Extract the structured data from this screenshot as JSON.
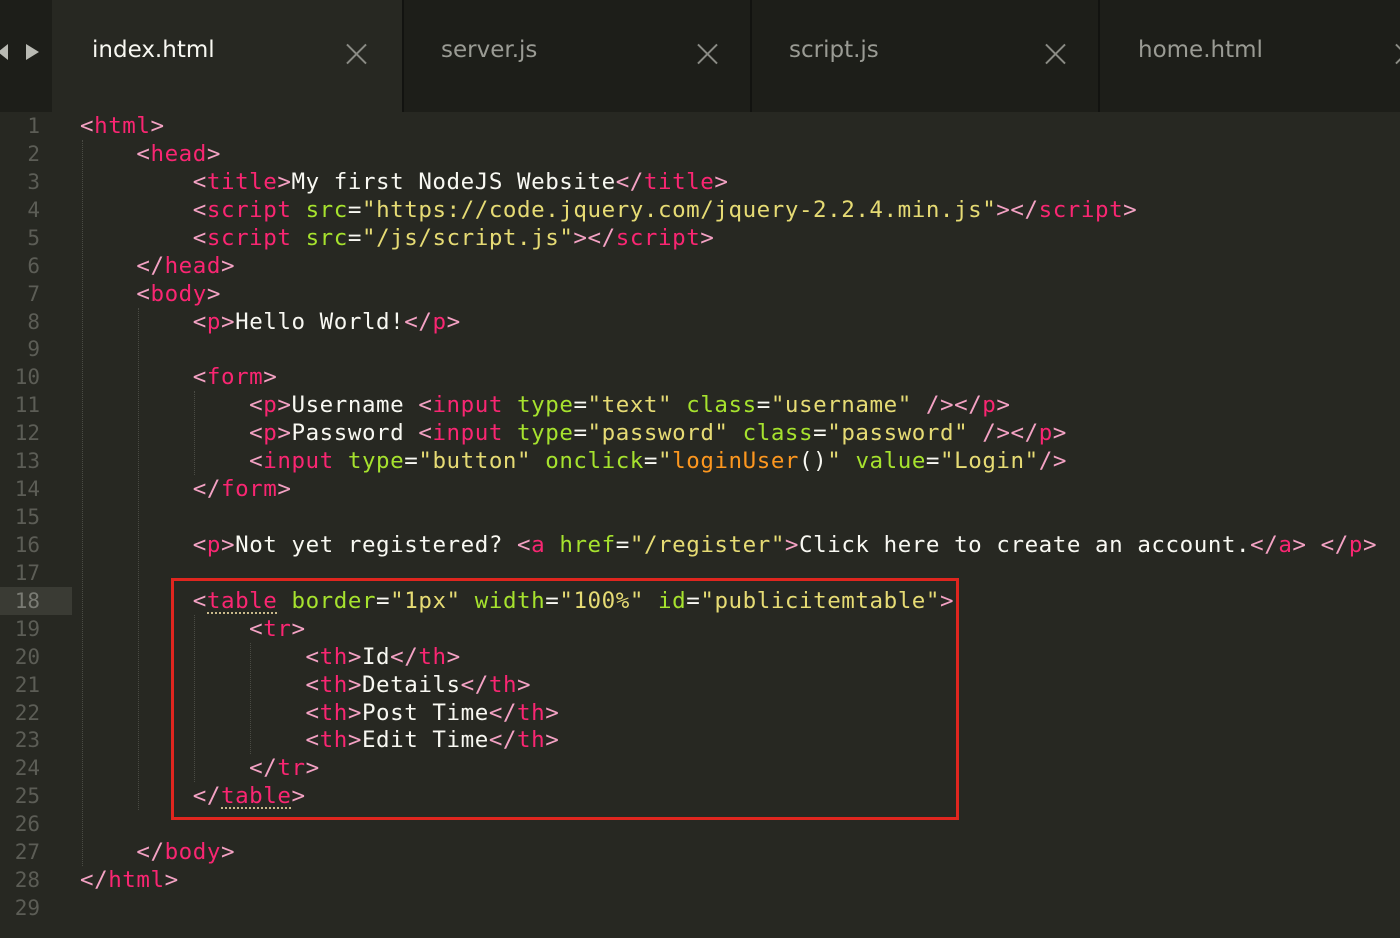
{
  "tabs": [
    {
      "label": "index.html",
      "active": true
    },
    {
      "label": "server.js",
      "active": false
    },
    {
      "label": "script.js",
      "active": false
    },
    {
      "label": "home.html",
      "active": false
    }
  ],
  "gutter": {
    "line_numbers": [
      "1",
      "2",
      "3",
      "4",
      "5",
      "6",
      "7",
      "8",
      "9",
      "10",
      "11",
      "12",
      "13",
      "14",
      "15",
      "16",
      "17",
      "18",
      "19",
      "20",
      "21",
      "22",
      "23",
      "24",
      "25",
      "26",
      "27",
      "28",
      "29"
    ],
    "current_line": "18"
  },
  "colors": {
    "tag": "#f92672",
    "attribute": "#a6e22e",
    "string": "#e6db74",
    "text": "#f8f8f2",
    "function": "#fd971f",
    "background": "#272822",
    "highlight_box": "#e0261f"
  },
  "code": {
    "lines": [
      [
        [
          "tag",
          "<"
        ],
        [
          "tagname",
          "html"
        ],
        [
          "tag",
          ">"
        ]
      ],
      [
        [
          "tag",
          "    <"
        ],
        [
          "tagname",
          "head"
        ],
        [
          "tag",
          ">"
        ]
      ],
      [
        [
          "tag",
          "        <"
        ],
        [
          "tagname",
          "title"
        ],
        [
          "tag",
          ">"
        ],
        [
          "text",
          "My first NodeJS Website"
        ],
        [
          "tag",
          "</"
        ],
        [
          "tagname",
          "title"
        ],
        [
          "tag",
          ">"
        ]
      ],
      [
        [
          "tag",
          "        <"
        ],
        [
          "tagname",
          "script"
        ],
        [
          "text",
          " "
        ],
        [
          "attr",
          "src"
        ],
        [
          "text",
          "="
        ],
        [
          "str",
          "\"https://code.jquery.com/jquery-2.2.4.min.js\""
        ],
        [
          "tag",
          "></"
        ],
        [
          "tagname",
          "script"
        ],
        [
          "tag",
          ">"
        ]
      ],
      [
        [
          "tag",
          "        <"
        ],
        [
          "tagname",
          "script"
        ],
        [
          "text",
          " "
        ],
        [
          "attr",
          "src"
        ],
        [
          "text",
          "="
        ],
        [
          "str",
          "\"/js/script.js\""
        ],
        [
          "tag",
          "></"
        ],
        [
          "tagname",
          "script"
        ],
        [
          "tag",
          ">"
        ]
      ],
      [
        [
          "tag",
          "    </"
        ],
        [
          "tagname",
          "head"
        ],
        [
          "tag",
          ">"
        ]
      ],
      [
        [
          "tag",
          "    <"
        ],
        [
          "tagname",
          "body"
        ],
        [
          "tag",
          ">"
        ]
      ],
      [
        [
          "tag",
          "        <"
        ],
        [
          "tagname",
          "p"
        ],
        [
          "tag",
          ">"
        ],
        [
          "text",
          "Hello World!"
        ],
        [
          "tag",
          "</"
        ],
        [
          "tagname",
          "p"
        ],
        [
          "tag",
          ">"
        ]
      ],
      [],
      [
        [
          "tag",
          "        <"
        ],
        [
          "tagname",
          "form"
        ],
        [
          "tag",
          ">"
        ]
      ],
      [
        [
          "tag",
          "            <"
        ],
        [
          "tagname",
          "p"
        ],
        [
          "tag",
          ">"
        ],
        [
          "text",
          "Username "
        ],
        [
          "tag",
          "<"
        ],
        [
          "tagname",
          "input"
        ],
        [
          "text",
          " "
        ],
        [
          "attr",
          "type"
        ],
        [
          "text",
          "="
        ],
        [
          "str",
          "\"text\""
        ],
        [
          "text",
          " "
        ],
        [
          "attr",
          "class"
        ],
        [
          "text",
          "="
        ],
        [
          "str",
          "\"username\""
        ],
        [
          "text",
          " "
        ],
        [
          "tag",
          "/></"
        ],
        [
          "tagname",
          "p"
        ],
        [
          "tag",
          ">"
        ]
      ],
      [
        [
          "tag",
          "            <"
        ],
        [
          "tagname",
          "p"
        ],
        [
          "tag",
          ">"
        ],
        [
          "text",
          "Password "
        ],
        [
          "tag",
          "<"
        ],
        [
          "tagname",
          "input"
        ],
        [
          "text",
          " "
        ],
        [
          "attr",
          "type"
        ],
        [
          "text",
          "="
        ],
        [
          "str",
          "\"password\""
        ],
        [
          "text",
          " "
        ],
        [
          "attr",
          "class"
        ],
        [
          "text",
          "="
        ],
        [
          "str",
          "\"password\""
        ],
        [
          "text",
          " "
        ],
        [
          "tag",
          "/></"
        ],
        [
          "tagname",
          "p"
        ],
        [
          "tag",
          ">"
        ]
      ],
      [
        [
          "tag",
          "            <"
        ],
        [
          "tagname",
          "input"
        ],
        [
          "text",
          " "
        ],
        [
          "attr",
          "type"
        ],
        [
          "text",
          "="
        ],
        [
          "str",
          "\"button\""
        ],
        [
          "text",
          " "
        ],
        [
          "attr",
          "onclick"
        ],
        [
          "text",
          "="
        ],
        [
          "str",
          "\""
        ],
        [
          "fn",
          "loginUser"
        ],
        [
          "text",
          "()"
        ],
        [
          "str",
          "\""
        ],
        [
          "text",
          " "
        ],
        [
          "attr",
          "value"
        ],
        [
          "text",
          "="
        ],
        [
          "str",
          "\"Login\""
        ],
        [
          "tag",
          "/>"
        ]
      ],
      [
        [
          "tag",
          "        </"
        ],
        [
          "tagname",
          "form"
        ],
        [
          "tag",
          ">"
        ]
      ],
      [],
      [
        [
          "tag",
          "        <"
        ],
        [
          "tagname",
          "p"
        ],
        [
          "tag",
          ">"
        ],
        [
          "text",
          "Not yet registered? "
        ],
        [
          "tag",
          "<"
        ],
        [
          "tagname",
          "a"
        ],
        [
          "text",
          " "
        ],
        [
          "attr",
          "href"
        ],
        [
          "text",
          "="
        ],
        [
          "str",
          "\"/register\""
        ],
        [
          "tag",
          ">"
        ],
        [
          "text",
          "Click here to create an account."
        ],
        [
          "tag",
          "</"
        ],
        [
          "tagname",
          "a"
        ],
        [
          "tag",
          ">"
        ],
        [
          "text",
          " "
        ],
        [
          "tag",
          "</"
        ],
        [
          "tagname",
          "p"
        ],
        [
          "tag",
          ">"
        ]
      ],
      [],
      [
        [
          "tag",
          "        <"
        ],
        [
          "tagname",
          "table"
        ],
        [
          "text",
          " "
        ],
        [
          "attr",
          "border"
        ],
        [
          "text",
          "="
        ],
        [
          "str",
          "\"1px\""
        ],
        [
          "text",
          " "
        ],
        [
          "attr",
          "width"
        ],
        [
          "text",
          "="
        ],
        [
          "str",
          "\"100%\""
        ],
        [
          "text",
          " "
        ],
        [
          "attr",
          "id"
        ],
        [
          "text",
          "="
        ],
        [
          "str",
          "\"publicitemtable\""
        ],
        [
          "tag",
          ">"
        ]
      ],
      [
        [
          "tag",
          "            <"
        ],
        [
          "tagname",
          "tr"
        ],
        [
          "tag",
          ">"
        ]
      ],
      [
        [
          "tag",
          "                <"
        ],
        [
          "tagname",
          "th"
        ],
        [
          "tag",
          ">"
        ],
        [
          "text",
          "Id"
        ],
        [
          "tag",
          "</"
        ],
        [
          "tagname",
          "th"
        ],
        [
          "tag",
          ">"
        ]
      ],
      [
        [
          "tag",
          "                <"
        ],
        [
          "tagname",
          "th"
        ],
        [
          "tag",
          ">"
        ],
        [
          "text",
          "Details"
        ],
        [
          "tag",
          "</"
        ],
        [
          "tagname",
          "th"
        ],
        [
          "tag",
          ">"
        ]
      ],
      [
        [
          "tag",
          "                <"
        ],
        [
          "tagname",
          "th"
        ],
        [
          "tag",
          ">"
        ],
        [
          "text",
          "Post Time"
        ],
        [
          "tag",
          "</"
        ],
        [
          "tagname",
          "th"
        ],
        [
          "tag",
          ">"
        ]
      ],
      [
        [
          "tag",
          "                <"
        ],
        [
          "tagname",
          "th"
        ],
        [
          "tag",
          ">"
        ],
        [
          "text",
          "Edit Time"
        ],
        [
          "tag",
          "</"
        ],
        [
          "tagname",
          "th"
        ],
        [
          "tag",
          ">"
        ]
      ],
      [
        [
          "tag",
          "            </"
        ],
        [
          "tagname",
          "tr"
        ],
        [
          "tag",
          ">"
        ]
      ],
      [
        [
          "tag",
          "        </"
        ],
        [
          "tagname",
          "table"
        ],
        [
          "tag",
          ">"
        ]
      ],
      [],
      [
        [
          "tag",
          "    </"
        ],
        [
          "tagname",
          "body"
        ],
        [
          "tag",
          ">"
        ]
      ],
      [
        [
          "tag",
          "</"
        ],
        [
          "tagname",
          "html"
        ],
        [
          "tag",
          ">"
        ]
      ],
      []
    ]
  }
}
